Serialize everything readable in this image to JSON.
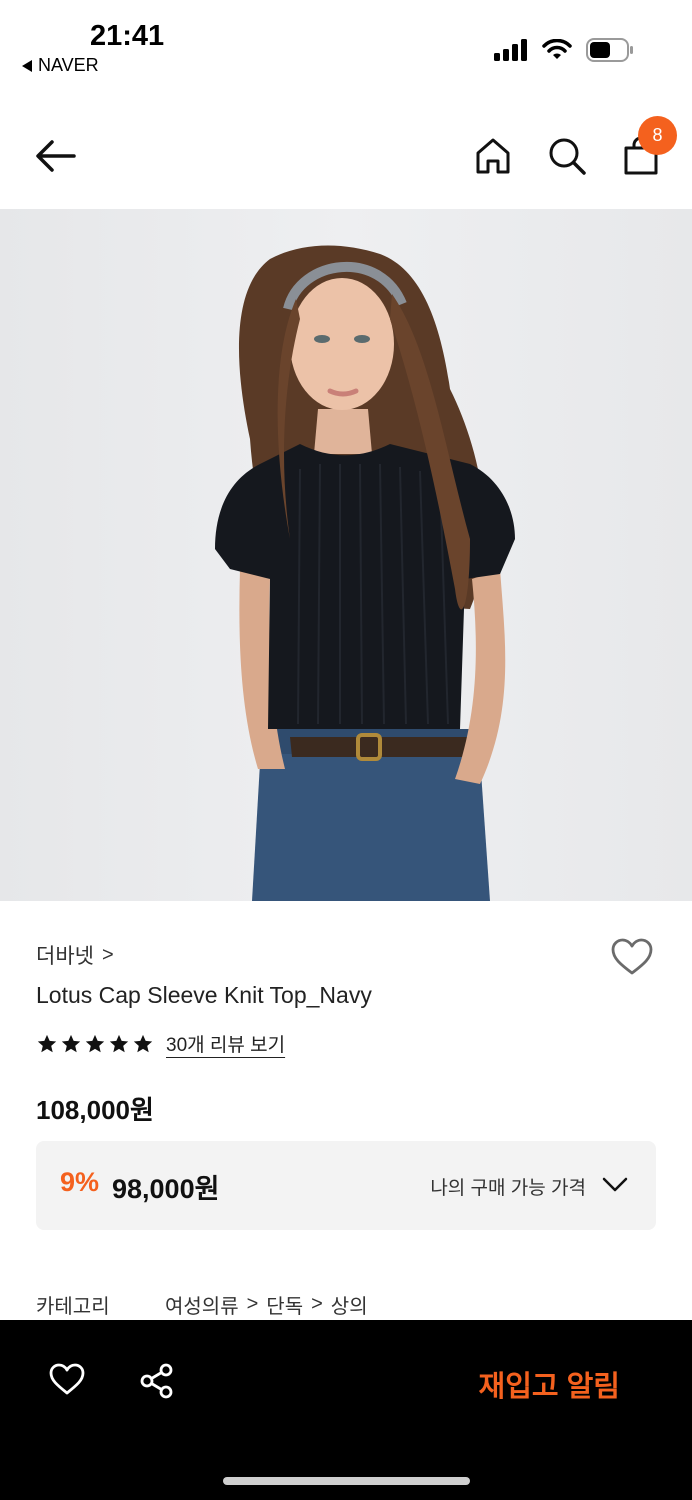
{
  "status_bar": {
    "time": "21:41",
    "back_app": "NAVER"
  },
  "header": {
    "cart_count": "8"
  },
  "product": {
    "brand": "더바넷",
    "brand_chevron": ">",
    "title": "Lotus Cap Sleeve Knit Top_Navy",
    "rating_stars": 5,
    "review_link": "30개 리뷰 보기",
    "price": "108,000원",
    "discount_pct": "9%",
    "discount_price": "98,000원",
    "my_price_label": "나의 구매 가능 가격"
  },
  "category": {
    "label": "카테고리",
    "path": [
      "여성의류",
      "단독",
      "상의"
    ],
    "separator": ">"
  },
  "bottom_bar": {
    "cta_label": "재입고 알림"
  },
  "colors": {
    "accent": "#f4611e",
    "bar_bg": "#000000",
    "box_bg": "#f3f3f3"
  }
}
